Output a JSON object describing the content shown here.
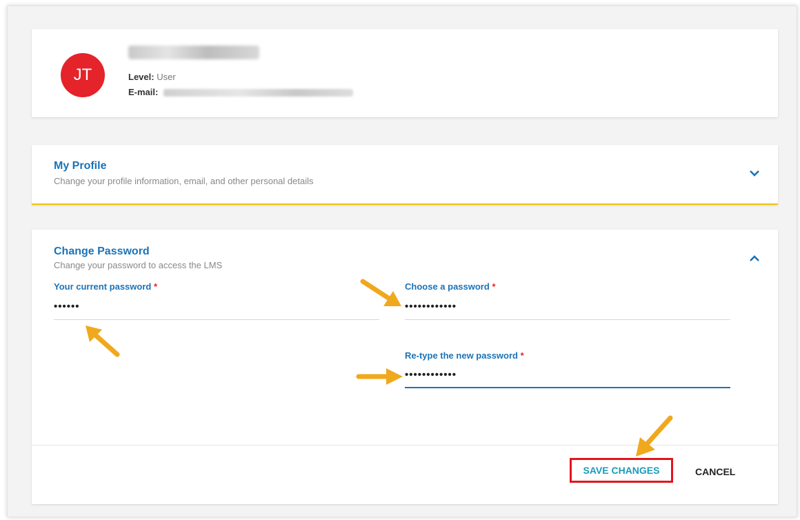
{
  "profile": {
    "initials": "JT",
    "level_label": "Level:",
    "level_value": "User",
    "email_label": "E-mail:"
  },
  "my_profile": {
    "title": "My Profile",
    "subtitle": "Change your profile information, email, and other personal details",
    "chevron": "⌄"
  },
  "change_password": {
    "title": "Change Password",
    "subtitle": "Change your password to access the LMS",
    "chevron": "⌃",
    "current_label": "Your current password",
    "current_value": "••••••",
    "choose_label": "Choose a password",
    "choose_value": "••••••••••••",
    "retype_label": "Re-type the new password",
    "retype_value": "••••••••••••",
    "required_mark": "*"
  },
  "actions": {
    "save_label": "SAVE CHANGES",
    "cancel_label": "CANCEL"
  },
  "colors": {
    "accent": "#1a73b8",
    "avatar": "#e4232b",
    "arrow": "#f0a81c",
    "highlight_border": "#e3141c",
    "section_underline": "#f2c400"
  }
}
